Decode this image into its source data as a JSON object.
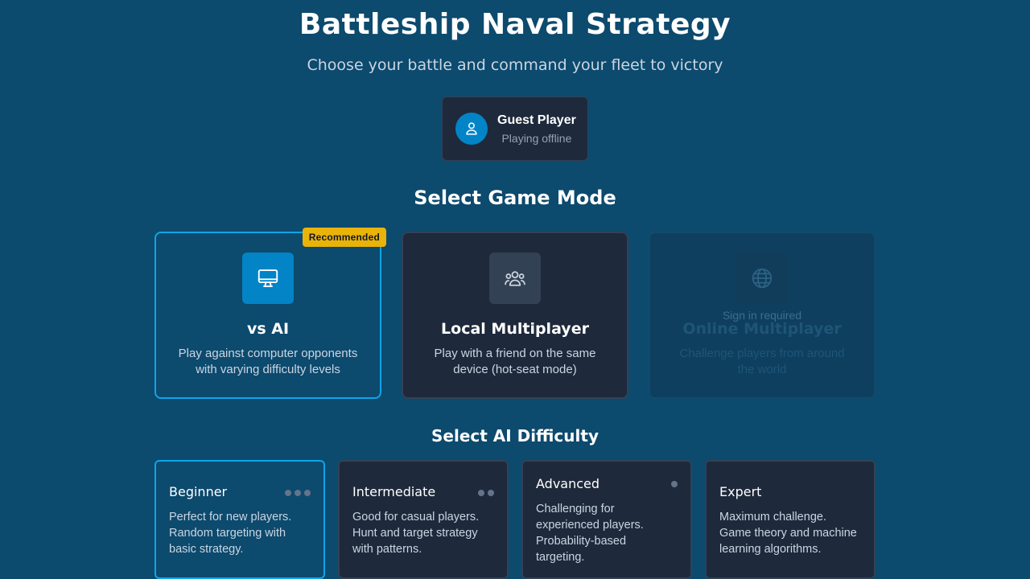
{
  "header": {
    "title": "Battleship Naval Strategy",
    "subtitle": "Choose your battle and command your fleet to victory"
  },
  "user": {
    "name": "Guest Player",
    "status": "Playing offline",
    "icon": "user-icon"
  },
  "modes": {
    "heading": "Select Game Mode",
    "items": [
      {
        "title": "vs AI",
        "description": "Play against computer opponents with varying difficulty levels",
        "badge": "Recommended",
        "icon": "monitor-icon",
        "selected": true
      },
      {
        "title": "Local Multiplayer",
        "description": "Play with a friend on the same device (hot-seat mode)",
        "icon": "users-icon"
      },
      {
        "title": "Online Multiplayer",
        "description": "Challenge players from around the world",
        "note": "Sign in required",
        "icon": "globe-icon",
        "disabled": true
      }
    ]
  },
  "difficulty": {
    "heading": "Select AI Difficulty",
    "items": [
      {
        "name": "Beginner",
        "description": "Perfect for new players. Random targeting with basic strategy.",
        "level_dots": 3,
        "selected": true
      },
      {
        "name": "Intermediate",
        "description": "Good for casual players. Hunt and target strategy with patterns.",
        "level_dots": 2
      },
      {
        "name": "Advanced",
        "description": "Challenging for experienced players. Probability-based targeting.",
        "level_dots": 1
      },
      {
        "name": "Expert",
        "description": "Maximum challenge. Game theory and machine learning algorithms.",
        "level_dots": 0
      }
    ]
  },
  "colors": {
    "background": "#0c4a6e",
    "card": "#1e293b",
    "accent": "#0ea5e9",
    "badge": "#eab308"
  }
}
